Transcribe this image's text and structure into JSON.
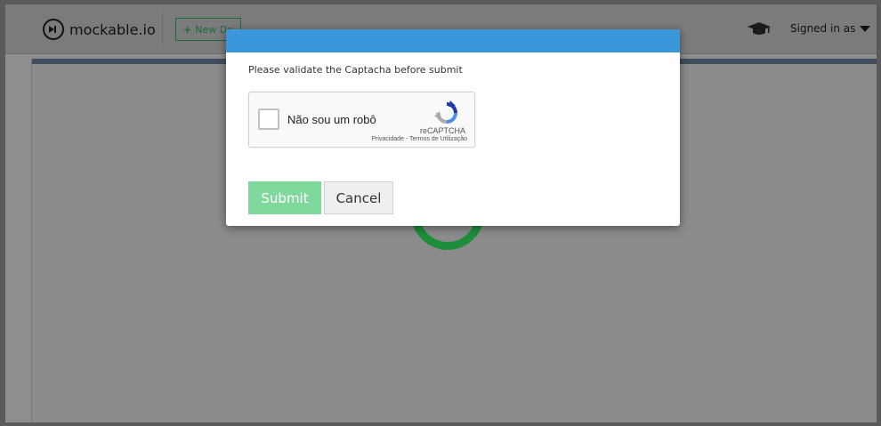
{
  "navbar": {
    "brand": "mockable.io",
    "new_domain_label": "New Do",
    "muted_text": "",
    "signed_in_label": "Signed in as"
  },
  "modal": {
    "message": "Please validate the Captacha before submit",
    "recaptcha": {
      "checkbox_label": "Não sou um robô",
      "brand": "reCAPTCHA",
      "terms": "Privacidade - Termos de Utilização"
    },
    "submit_label": "Submit",
    "cancel_label": "Cancel"
  },
  "colors": {
    "modal_header": "#3a97d9",
    "submit_bg": "#7fd99d",
    "spinner": "#1d8f3a"
  }
}
